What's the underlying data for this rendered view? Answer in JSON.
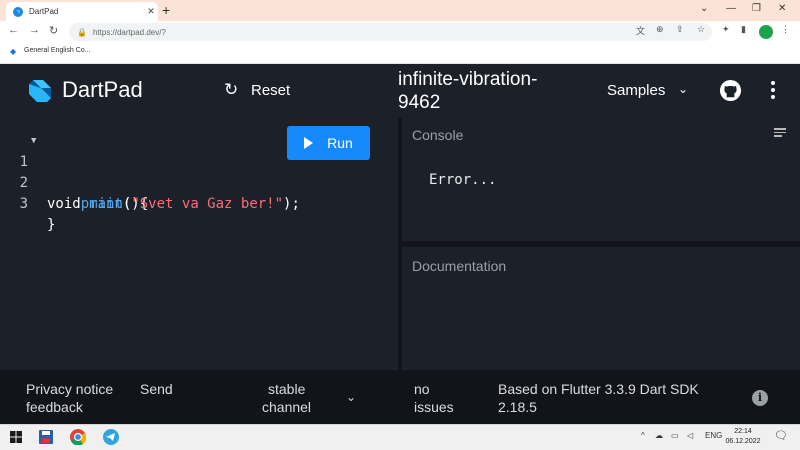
{
  "browser": {
    "tab_title": "DartPad",
    "url": "https://dartpad.dev/?",
    "bookmark": "General English Co..."
  },
  "header": {
    "brand": "DartPad",
    "reset_label": "Reset",
    "pad_title": "infinite-vibration-9462",
    "samples_label": "Samples"
  },
  "editor": {
    "run_label": "Run",
    "lines": [
      {
        "num": "1"
      },
      {
        "num": "2"
      },
      {
        "num": "3"
      }
    ],
    "line1": {
      "kw": "void ",
      "fn": "main",
      "rest": "(){"
    },
    "line2": {
      "indent": "    ",
      "fn": "print",
      "open": "(",
      "str": "\"Svet va Gaz ber!\"",
      "close": ");"
    },
    "line3": {
      "text": "}"
    }
  },
  "console": {
    "title": "Console",
    "output": "Error..."
  },
  "documentation": {
    "title": "Documentation"
  },
  "footer": {
    "privacy": "Privacy notice",
    "send": "Send",
    "feedback": "feedback",
    "channel_line1": "stable",
    "channel_line2": "channel",
    "issues_line1": "no",
    "issues_line2": "issues",
    "sdk_line1": "Based on Flutter 3.3.9 Dart SDK",
    "sdk_line2": "2.18.5"
  },
  "taskbar": {
    "language": "ENG",
    "time": "22:14",
    "date": "06.12.2022"
  },
  "colors": {
    "run_button": "#168afd",
    "background": "#1b2029",
    "footer": "#11151b"
  }
}
